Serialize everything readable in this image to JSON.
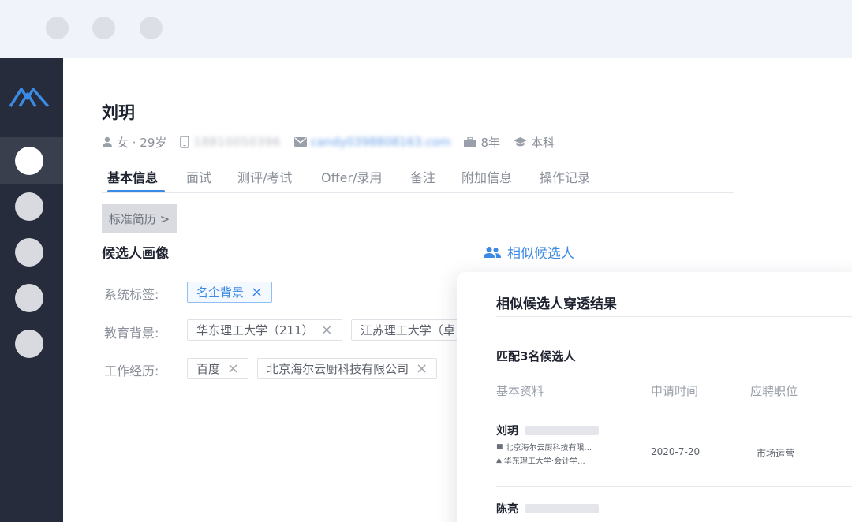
{
  "colors": {
    "accent": "#3d8ae5",
    "sidebar": "#272c3c",
    "titlebar": "#f1f3fa"
  },
  "window_controls": [
    "close-dot",
    "minimize-dot",
    "maximize-dot"
  ],
  "sidebar": {
    "logo": "app-logo-icon",
    "items": [
      {
        "icon": "nav-dot",
        "active": true
      },
      {
        "icon": "nav-dot",
        "active": false
      },
      {
        "icon": "nav-dot",
        "active": false
      },
      {
        "icon": "nav-dot",
        "active": false
      },
      {
        "icon": "nav-dot",
        "active": false
      }
    ]
  },
  "candidate": {
    "name": "刘玥",
    "gender_age": "女 · 29岁",
    "phone": "18810050396",
    "email": "candy0398808163.com",
    "experience": "8年",
    "education": "本科",
    "icons": [
      "user-icon",
      "phone-icon",
      "mail-icon",
      "briefcase-icon",
      "graduation-cap-icon"
    ]
  },
  "tabs": [
    {
      "label": "基本信息",
      "active": true
    },
    {
      "label": "面试"
    },
    {
      "label": "测评/考试"
    },
    {
      "label": "Offer/录用"
    },
    {
      "label": "备注"
    },
    {
      "label": "附加信息"
    },
    {
      "label": "操作记录"
    }
  ],
  "resume_button": "标准简历 >",
  "profile": {
    "title": "候选人画像",
    "rows": [
      {
        "label": "系统标签:",
        "tags": [
          "名企背景"
        ]
      },
      {
        "label": "教育背景:",
        "tags": [
          "华东理工大学（211）",
          "江苏理工大学（卓"
        ]
      },
      {
        "label": "工作经历:",
        "tags": [
          "百度",
          "北京海尔云厨科技有限公司"
        ]
      }
    ]
  },
  "similar": {
    "link_label": "相似候选人",
    "panel_title": "相似候选人穿透结果",
    "match_text": "匹配3名候选人",
    "columns": [
      "基本资料",
      "申请时间",
      "应聘职位"
    ],
    "rows": [
      {
        "name": "刘玥",
        "company": "北京海尔云厨科技有限...",
        "school": "华东理工大学·会计学...",
        "apply_date": "2020-7-20",
        "position": "市场运营"
      },
      {
        "name": "陈亮"
      }
    ]
  }
}
